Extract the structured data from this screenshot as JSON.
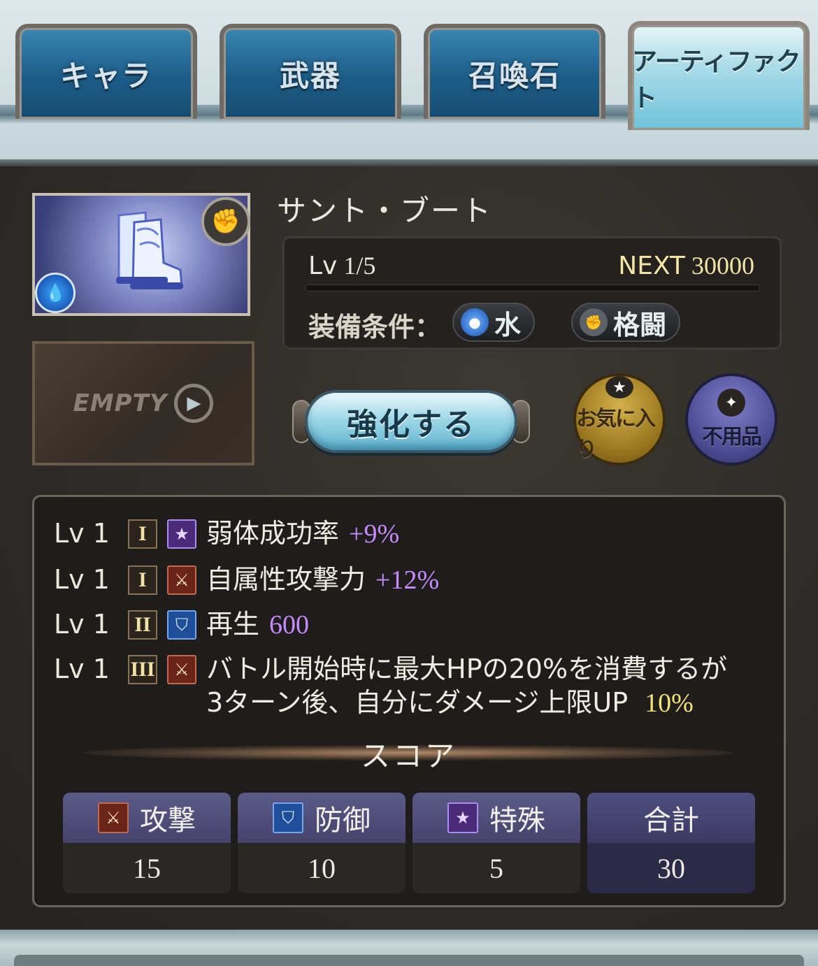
{
  "tabs": [
    {
      "label": "キャラ",
      "active": false
    },
    {
      "label": "武器",
      "active": false
    },
    {
      "label": "召喚石",
      "active": false
    },
    {
      "label": "アーティファクト",
      "active": true
    }
  ],
  "item": {
    "name": "サント・ブート",
    "weapon_type_icon": "fist-icon",
    "element_icon": "water-icon",
    "level_label": "Lv",
    "level": "1/5",
    "next_label": "NEXT",
    "next_value": "30000",
    "exp_progress": 0.0,
    "condition_label": "装備条件：",
    "conditions": [
      {
        "icon": "water-orb-icon",
        "label": "水",
        "color": "#3d8de8"
      },
      {
        "icon": "fist-icon",
        "label": "格闘",
        "color": "#cfd8dc"
      }
    ]
  },
  "empty_slot": {
    "label": "EMPTY"
  },
  "buttons": {
    "upgrade": "強化する",
    "favorite": "お気に入り",
    "junk": "不用品"
  },
  "skills": [
    {
      "level": "Lv 1",
      "tier": "I",
      "category": "special",
      "name": "弱体成功率",
      "value": "+9%"
    },
    {
      "level": "Lv 1",
      "tier": "I",
      "category": "attack",
      "name": "自属性攻撃力",
      "value": "+12%"
    },
    {
      "level": "Lv 1",
      "tier": "II",
      "category": "defense",
      "name": "再生",
      "value": "600"
    },
    {
      "level": "Lv 1",
      "tier": "III",
      "category": "attack",
      "line1": "バトル開始時に最大HPの20%を消費するが",
      "line2": "3ターン後、自分にダメージ上限UP",
      "value": "10%"
    }
  ],
  "score": {
    "title": "スコア",
    "columns": [
      {
        "label": "攻撃",
        "value": "15",
        "icon": "attack-icon"
      },
      {
        "label": "防御",
        "value": "10",
        "icon": "defense-icon"
      },
      {
        "label": "特殊",
        "value": "5",
        "icon": "special-icon"
      },
      {
        "label": "合計",
        "value": "30"
      }
    ]
  },
  "colors": {
    "accent_blue": "#1c5d88",
    "active_tab": "#a9dbe8",
    "skill_value_purple": "#c68cff",
    "skill_value_yellow": "#f2e27c",
    "next_gold": "#f2e5a5"
  }
}
